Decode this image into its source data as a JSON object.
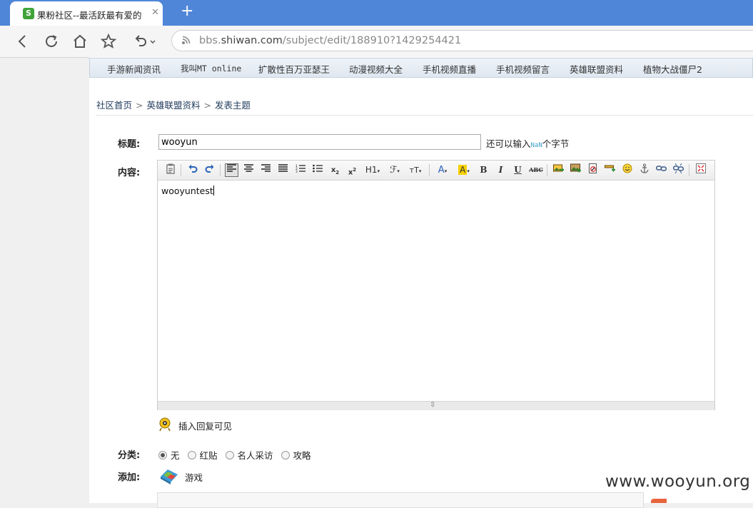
{
  "browser": {
    "tab_title": "果粉社区--最活跃最有爱的",
    "tab_icon": "favicon-icon",
    "new_tab": "+",
    "address": {
      "prefix": "bbs.",
      "domain": "shiwan.com",
      "path": "/subject/edit/188910?1429254421"
    }
  },
  "nav": {
    "items": [
      "手游新闻资讯",
      "我叫MT online",
      "扩散性百万亚瑟王",
      "动漫视频大全",
      "手机视频直播",
      "手机视频留言",
      "英雄联盟资料",
      "植物大战僵尸2"
    ]
  },
  "breadcrumb": {
    "home": "社区首页",
    "forum": "英雄联盟资料",
    "current": "发表主题",
    "sep": ">"
  },
  "form": {
    "title_label": "标题:",
    "title_value": "wooyun",
    "remain_prefix": "还可以输入",
    "remain_count": "NaN",
    "remain_suffix": "个字节",
    "content_label": "内容:",
    "content_text": "wooyuntest",
    "reply_label": "插入回复可见",
    "category_label": "分类:",
    "categories": [
      "无",
      "红贴",
      "名人采访",
      "攻略"
    ],
    "category_selected": "无",
    "add_label": "添加:",
    "add_item": "游戏"
  },
  "editor_toolbar": {
    "h1": "H1",
    "font": "ℱ",
    "size": "тT",
    "color": "A",
    "bg": "A",
    "bold": "B",
    "italic": "I",
    "underline": "U",
    "strike": "ABC"
  },
  "watermark": "www.wooyun.org"
}
